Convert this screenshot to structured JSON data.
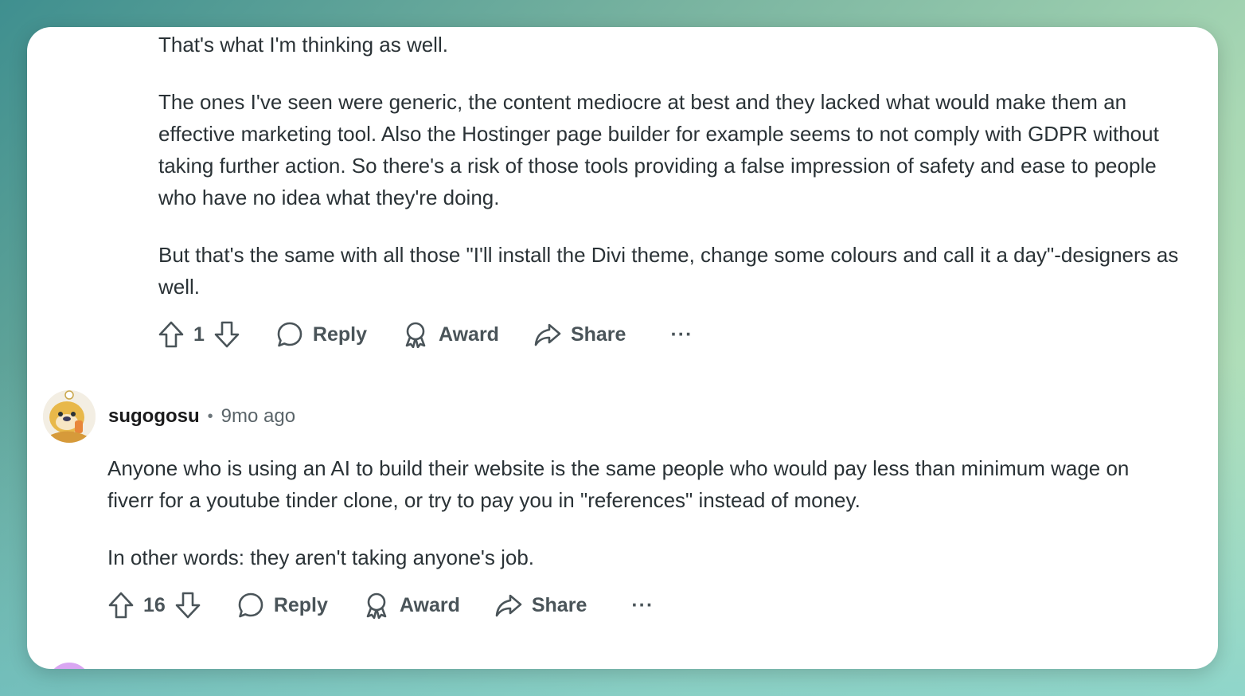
{
  "comment1": {
    "paragraphs": [
      "That's what I'm thinking as well.",
      "The ones I've seen were generic, the content mediocre at best and they lacked what would make them an effective marketing tool. Also the Hostinger page builder for example seems to not comply with GDPR without taking further action. So there's a risk of those tools providing a false impression of safety and ease to people who have no idea what they're doing.",
      "But that's the same with all those \"I'll install the Divi theme, change some colours and call it a day\"-designers as well."
    ],
    "votes": "1",
    "reply_label": "Reply",
    "award_label": "Award",
    "share_label": "Share",
    "more_label": "···"
  },
  "comment2": {
    "username": "sugogosu",
    "separator": "•",
    "time": "9mo ago",
    "paragraphs": [
      "Anyone who is using an AI to build their website is the same people who would pay less than minimum wage on fiverr for a youtube tinder clone, or try to pay you in \"references\" instead of money.",
      "In other words: they aren't taking anyone's job."
    ],
    "votes": "16",
    "reply_label": "Reply",
    "award_label": "Award",
    "share_label": "Share",
    "more_label": "···"
  },
  "icons": {
    "upvote": "arrow-up-icon",
    "downvote": "arrow-down-icon",
    "reply": "speech-bubble-icon",
    "award": "award-ribbon-icon",
    "share": "share-arrow-icon",
    "more": "ellipsis-icon"
  },
  "colors": {
    "text": "#2a3236",
    "action_text": "#4a5459",
    "card_background": "#ffffff",
    "peek_avatar": "#d9a6f2"
  }
}
